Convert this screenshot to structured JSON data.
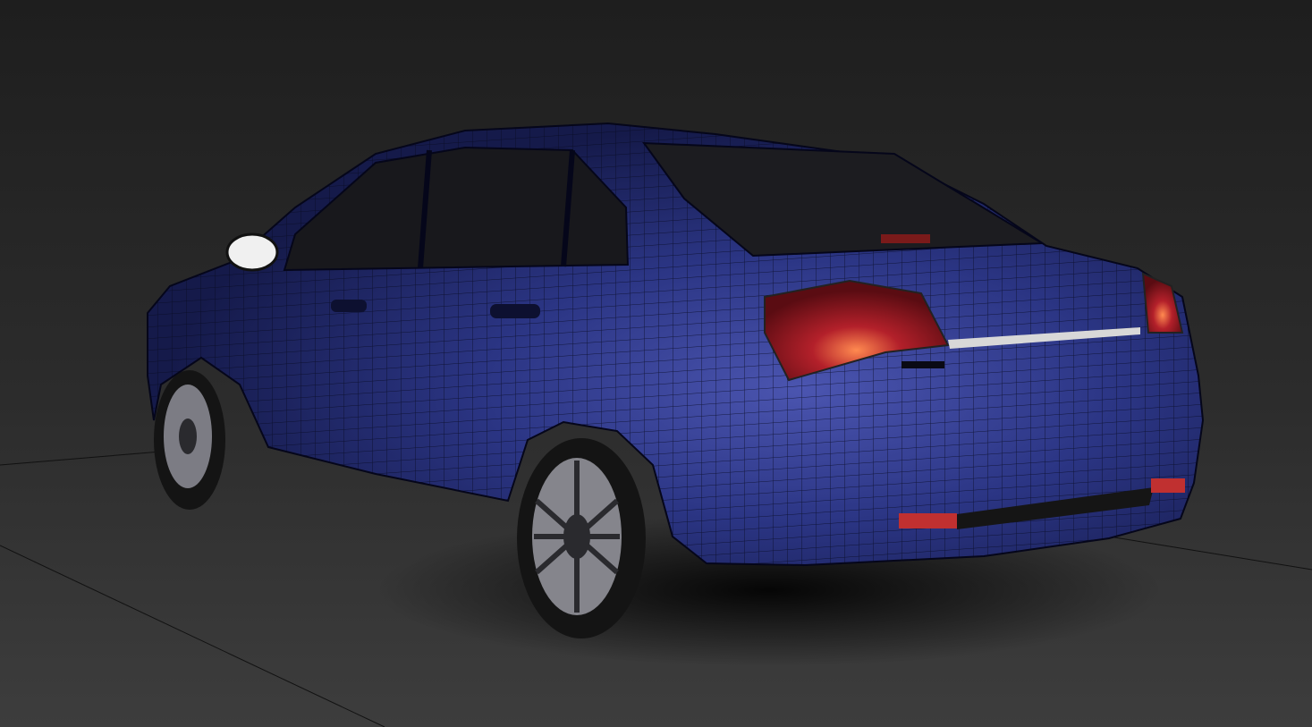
{
  "scene": {
    "subject": "sedan-car-wireframe-render",
    "colors": {
      "background_top": "#1f1f1f",
      "floor": "#3b3b3b",
      "body": "#2a3480",
      "body_highlight": "#5a64c0",
      "mesh_line": "#0a0c22",
      "glass": "#1a1a1e",
      "taillight": "#c0222a",
      "taillight_glow": "#ff7a40",
      "chrome": "#d8d8d8",
      "tire": "#141414",
      "rim": "#8a8a90",
      "mirror": "#f2f2f2"
    }
  }
}
